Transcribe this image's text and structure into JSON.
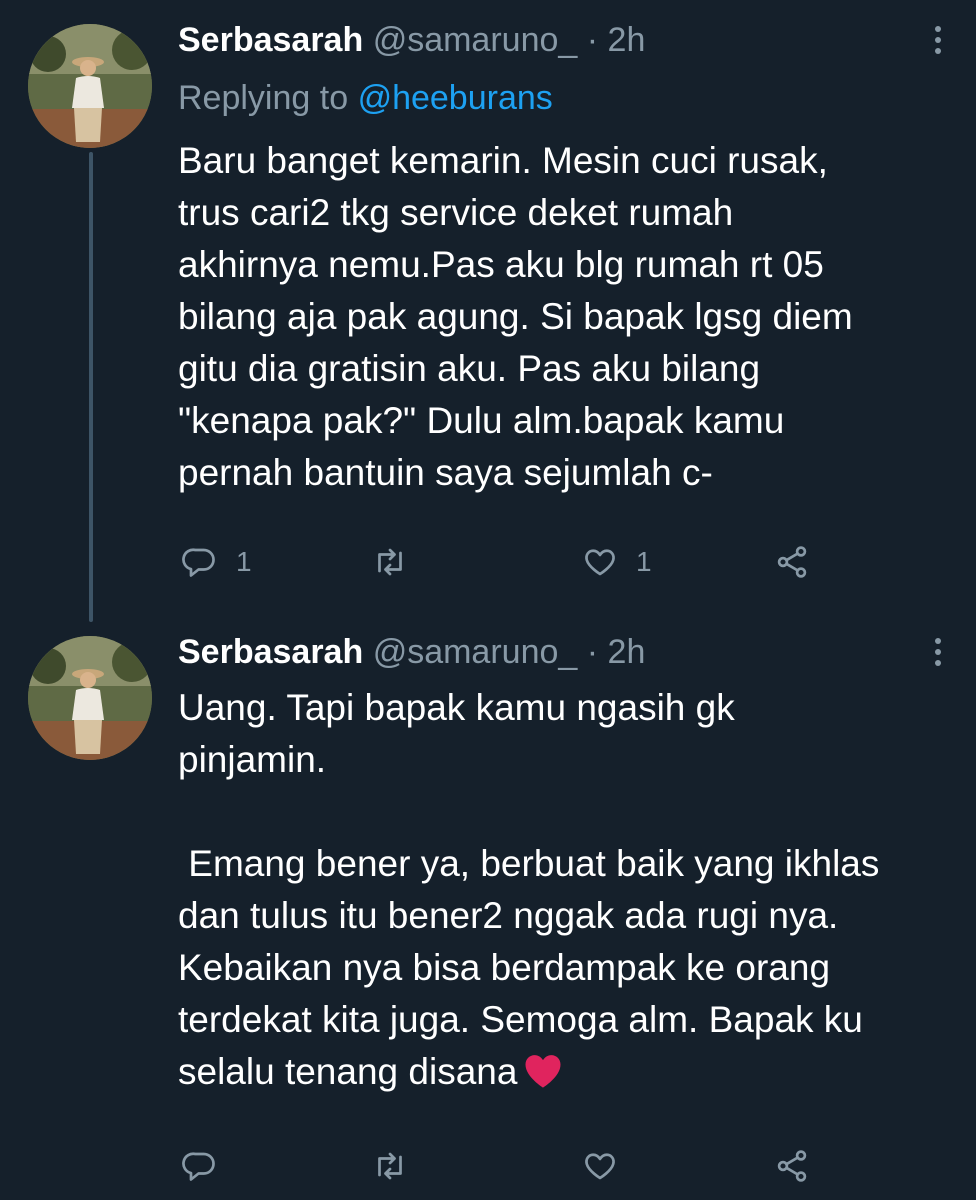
{
  "tweets": [
    {
      "author": {
        "name": "Serbasarah",
        "handle": "@samaruno_"
      },
      "separator": "·",
      "time": "2h",
      "replying_to": {
        "prefix": "Replying to",
        "mention": "@heeburans"
      },
      "text": "Baru banget kemarin. Mesin cuci rusak,\ntrus cari2 tkg service deket rumah\nakhirnya nemu.Pas aku blg rumah rt 05\nbilang aja pak agung. Si bapak lgsg diem\ngitu dia gratisin aku. Pas aku bilang\n\"kenapa pak?\" Dulu alm.bapak kamu\npernah bantuin saya sejumlah c-",
      "counts": {
        "replies": "1",
        "retweets": "",
        "likes": "1"
      }
    },
    {
      "author": {
        "name": "Serbasarah",
        "handle": "@samaruno_"
      },
      "separator": "·",
      "time": "2h",
      "text": "Uang. Tapi bapak kamu ngasih gk\npinjamin.\n\n Emang bener ya, berbuat baik yang ikhlas\ndan tulus itu bener2 nggak ada rugi nya.\nKebaikan nya bisa berdampak ke orang\nterdekat kita juga. Semoga alm. Bapak ku\nselalu tenang disana",
      "emoji": "red-heart-emoji",
      "counts": {
        "replies": "",
        "retweets": "",
        "likes": ""
      }
    }
  ],
  "icons": {
    "reply": "reply-icon",
    "retweet": "retweet-icon",
    "like": "like-icon",
    "share": "share-icon",
    "more": "more-vertical-icon"
  },
  "colors": {
    "background": "#15202b",
    "primary_text": "#ffffff",
    "secondary_text": "#8899a6",
    "mention": "#1da1f2",
    "thread_line": "#3d5466",
    "heart_emoji": "#e0245e"
  }
}
